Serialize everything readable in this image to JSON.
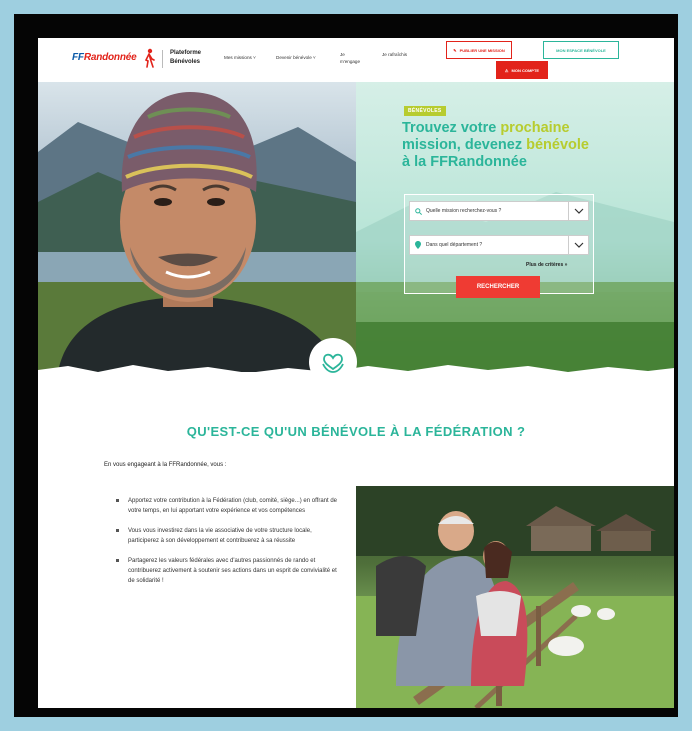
{
  "header": {
    "logo_text_prefix": "FF",
    "logo_text": "Randonnée",
    "platform": "Plateforme Bénévoles",
    "nav": [
      {
        "label": "Mes missions ˅"
      },
      {
        "label": "Devenir bénévole ˅"
      },
      {
        "label": "Je m'engage"
      },
      {
        "label": "Je rafraîchis"
      }
    ],
    "btn_publish": "Publier une mission",
    "btn_member": "Mon espace bénévole",
    "btn_red": "Mon compte"
  },
  "hero": {
    "badge": "BÉNÉVOLES",
    "title_1": "Trouvez votre ",
    "title_1_lime": "prochaine",
    "title_2": "mission, devenez ",
    "title_2_lime": "bénévole",
    "title_3": "à la FFRandonnée",
    "search_placeholder": "Quelle mission recherchez-vous ?",
    "dept_placeholder": "Dans quel département ?",
    "more_criteria": "Plus de critères »",
    "search_button": "RECHERCHER"
  },
  "section": {
    "title": "QU'EST-CE QU'UN BÉNÉVOLE À LA FÉDÉRATION ?",
    "intro": "En vous engageant à la FFRandonnée, vous :",
    "bullets": [
      "Apportez votre contribution à la Fédération (club, comité, siège...) en offrant de votre temps, en lui apportant votre expérience et vos compétences",
      "Vous vous investirez dans la vie associative de votre structure locale, participerez à son développement et contribuerez à sa réussite",
      "Partagerez les valeurs fédérales avec d'autres passionnés de rando et contribuerez activement à soutenir ses actions dans un esprit de convivialité et de solidarité !"
    ]
  },
  "colors": {
    "brand_green": "#2bb59a",
    "brand_lime": "#b7cc2f",
    "brand_red": "#e2231a",
    "brand_blue": "#0b5aa8"
  }
}
